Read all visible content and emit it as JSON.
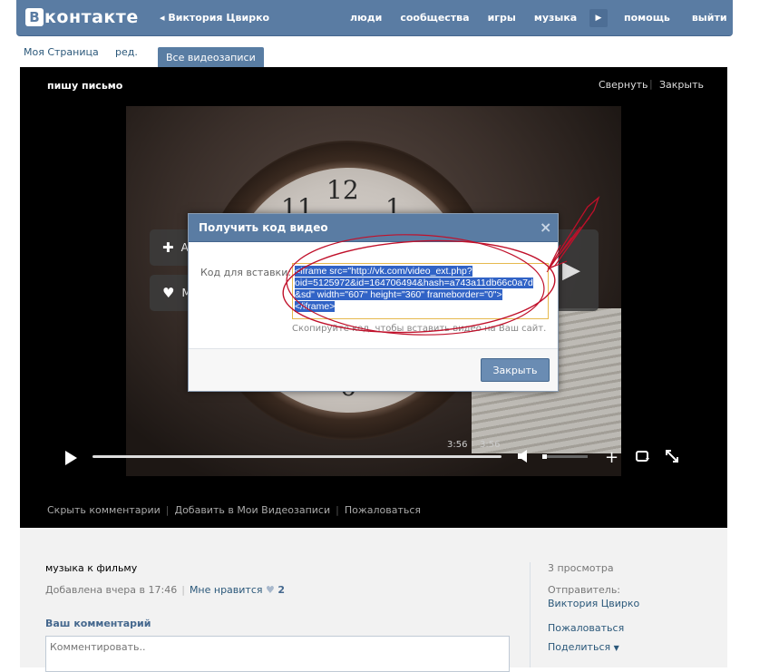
{
  "header": {
    "logo_letter": "В",
    "logo_text": "контакте",
    "profile_name": "Виктория Цвирко",
    "nav": [
      "люди",
      "сообщества",
      "игры",
      "музыка"
    ],
    "nav_right": [
      "помощь",
      "выйти"
    ]
  },
  "subbar": {
    "my_page": "Моя Страница",
    "edit": "ред.",
    "all_videos": "Все видеозаписи"
  },
  "video": {
    "title": "пишу письмо",
    "collapse": "Свернуть",
    "separator": "|",
    "close": "Закрыть",
    "add_initial": "А",
    "like_initial": "М",
    "time_current": "3:56",
    "time_total": "3:56",
    "volume_fraction": 0.1
  },
  "video_links": [
    "Скрыть комментарии",
    "Добавить в Мои Видеозаписи",
    "Пожаловаться"
  ],
  "info": {
    "description": "музыка к фильму",
    "added": "Добавлена вчера в 17:46",
    "dislike": "Мне нравится",
    "likes_count": "2",
    "your_comment": "Ваш комментарий",
    "comment_placeholder": "Комментировать..",
    "views": "3 просмотра",
    "sender_label": "Отправитель:",
    "sender": "Виктория Цвирко",
    "report": "Пожаловаться",
    "share": "Поделиться"
  },
  "modal": {
    "title": "Получить код видео",
    "close_icon": "×",
    "embed_label": "Код для вставки:",
    "embed_lines": [
      "<iframe src=\"http://vk.com/video_ext.php?",
      "oid=5125972&id=164706494&hash=a743a11db66c0a7d",
      "&sd\" width=\"607\" height=\"360\" frameborder=\"0\">",
      "</iframe>"
    ],
    "hint": "Скопируйте код, чтобы вставить видео на Ваш сайт.",
    "close_button": "Закрыть"
  },
  "colors": {
    "brand": "#5a7ca3",
    "link": "#2b587a",
    "annotation": "#c0102a"
  }
}
